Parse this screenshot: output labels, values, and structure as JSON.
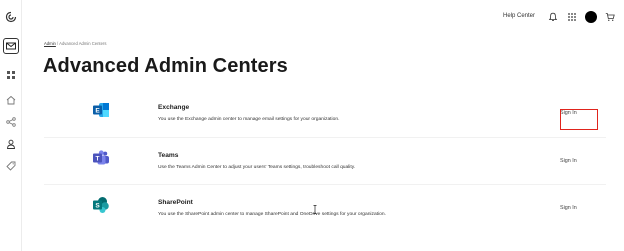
{
  "topbar": {
    "help_label": "Help Center"
  },
  "breadcrumb": {
    "root": "Admin",
    "separator": "/",
    "current": "Advanced Admin Centers"
  },
  "page": {
    "title": "Advanced Admin Centers"
  },
  "products": [
    {
      "name": "Exchange",
      "description": "You use the Exchange admin center to manage email settings for your organization.",
      "action": "Sign In"
    },
    {
      "name": "Teams",
      "description": "Use the Teams Admin Center to adjust your users' Teams settings, troubleshoot call quality.",
      "action": "Sign In"
    },
    {
      "name": "SharePoint",
      "description": "You use the SharePoint admin center to manage SharePoint and OneDrive settings for your organization.",
      "action": "Sign In"
    }
  ],
  "colors": {
    "highlight": "#e0241d",
    "exchange": "#28a8ea",
    "teams": "#5059c9",
    "sharepoint": "#038387"
  }
}
